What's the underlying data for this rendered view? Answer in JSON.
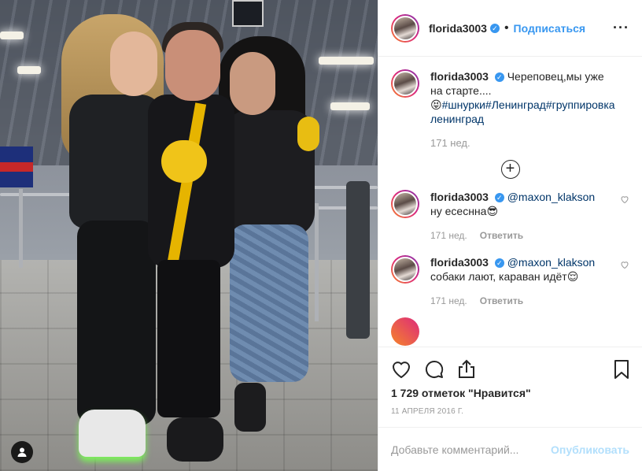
{
  "post": {
    "username": "florida3003",
    "follow_label": "Подписаться",
    "more_icon": "more-dots-icon",
    "verified_mark": "✓"
  },
  "caption": {
    "username": "florida3003",
    "text": "Череповец,мы уже на старте....",
    "emoji": "😝",
    "tags": "#шнурки#Ленинград#группировка ленинград",
    "age": "171 нед."
  },
  "comments": [
    {
      "username": "florida3003",
      "mention": "@maxon_klakson",
      "text": "ну есесннa😎",
      "age": "171 нед.",
      "reply_label": "Ответить"
    },
    {
      "username": "florida3003",
      "mention": "@maxon_klakson",
      "text": "собаки лают, караван идёт😌",
      "age": "171 нед.",
      "reply_label": "Ответить"
    }
  ],
  "load_more_icon": "plus-circle-icon",
  "likes": "1 729 отметок \"Нравится\"",
  "date": "11 АПРЕЛЯ 2016 Г.",
  "add_comment": {
    "placeholder": "Добавьте комментарий...",
    "post_label": "Опубликовать"
  },
  "colors": {
    "link": "#3897f0",
    "hashtag": "#003569",
    "muted": "#999999"
  }
}
